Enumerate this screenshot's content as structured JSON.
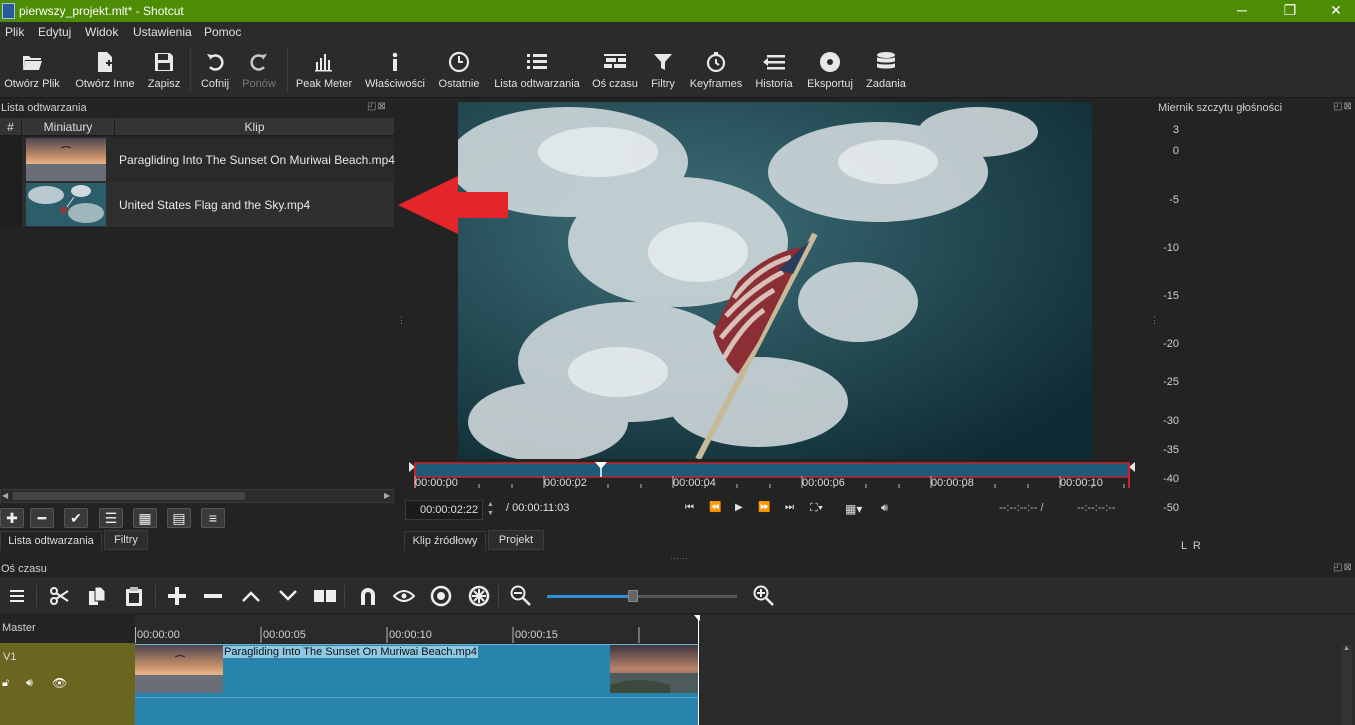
{
  "window": {
    "title": "pierwszy_projekt.mlt* - Shotcut",
    "minimize": "─",
    "maximize": "❐",
    "close": "✕"
  },
  "menu": [
    "Plik",
    "Edytuj",
    "Widok",
    "Ustawienia",
    "Pomoc"
  ],
  "toolbar": {
    "open_file": "Otwórz Plik",
    "open_other": "Otwórz Inne",
    "save": "Zapisz",
    "undo": "Cofnij",
    "redo": "Ponów",
    "peak_meter": "Peak Meter",
    "properties": "Właściwości",
    "recent": "Ostatnie",
    "playlist": "Lista odtwarzania",
    "timeline": "Oś czasu",
    "filters": "Filtry",
    "keyframes": "Keyframes",
    "history": "Historia",
    "export": "Eksportuj",
    "jobs": "Zadania"
  },
  "playlist": {
    "title": "Lista odtwarzania",
    "columns": [
      "#",
      "Miniatury",
      "Klip"
    ],
    "items": [
      {
        "clip": "Paragliding Into The Sunset On Muriwai Beach.mp4"
      },
      {
        "clip": "United States Flag and the Sky.mp4"
      }
    ],
    "tabs": [
      "Lista odtwarzania",
      "Filtry"
    ]
  },
  "player": {
    "ruler_ticks": [
      "00:00:00",
      "00:00:02",
      "00:00:04",
      "00:00:06",
      "00:00:08",
      "00:00:10"
    ],
    "position": "00:00:02:22",
    "duration": "/ 00:00:11:03",
    "in_point": "--:--:--:-- /",
    "out_point": "--:--:--:--",
    "tabs": [
      "Klip źródłowy",
      "Projekt"
    ]
  },
  "meter": {
    "title": "Miernik szczytu głośności",
    "scale": [
      "3",
      "0",
      "-5",
      "-10",
      "-15",
      "-20",
      "-25",
      "-30",
      "-35",
      "-40",
      "-50"
    ],
    "channels": "L  R"
  },
  "timeline": {
    "title": "Oś czasu",
    "master": "Master",
    "track": "V1",
    "ruler_ticks": [
      "00:00:00",
      "00:00:05",
      "00:00:10",
      "00:00:15"
    ],
    "clip_name": "Paragliding Into The Sunset On Muriwai Beach.mp4",
    "zoom_level": 0.45
  },
  "colors": {
    "titlebar": "#4e8c06",
    "arrow": "#e4262a",
    "clip": "#2883ad",
    "track": "#6a6520"
  }
}
